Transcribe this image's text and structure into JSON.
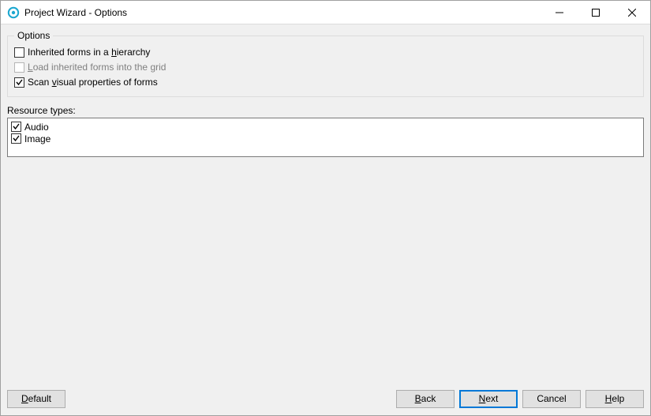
{
  "window": {
    "title": "Project Wizard - Options"
  },
  "options_group": {
    "legend": "Options",
    "inherited": {
      "label_pre": "Inherited forms in a ",
      "label_accel": "h",
      "label_post": "ierarchy",
      "checked": false
    },
    "load_inherited": {
      "label_accel": "L",
      "label_post": "oad inherited forms into the grid",
      "checked": false,
      "disabled": true
    },
    "scan_visual": {
      "label_pre": "Scan ",
      "label_accel": "v",
      "label_post": "isual properties of forms",
      "checked": true
    }
  },
  "resource_types": {
    "label_accel": "R",
    "label_post": "esource types:",
    "items": [
      {
        "label": "Audio",
        "checked": true
      },
      {
        "label": "Image",
        "checked": true
      }
    ]
  },
  "buttons": {
    "default_accel": "D",
    "default_post": "efault",
    "back_accel": "B",
    "back_post": "ack",
    "next_accel": "N",
    "next_post": "ext",
    "cancel": "Cancel",
    "help_accel": "H",
    "help_post": "elp"
  }
}
